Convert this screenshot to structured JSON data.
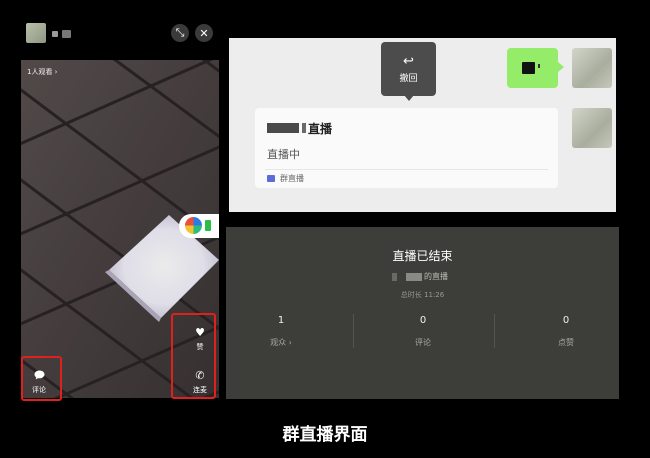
{
  "phone": {
    "viewer_count": "1人观看 ›",
    "like_label": "赞",
    "comment_label": "评论",
    "mic_label": "连麦",
    "close_glyph": "✕",
    "shrink_glyph": "⤡"
  },
  "chat": {
    "recall_icon": "↩",
    "recall_label": "撤回",
    "live_title": "直播",
    "live_status": "直播中",
    "group_live_label": "群直播",
    "group_live_icon": "live-icon"
  },
  "ended": {
    "title": "直播已结束",
    "host_suffix": "的直播",
    "duration": "总时长 11:26",
    "stats": [
      {
        "value": "1",
        "label": "观众 ›"
      },
      {
        "value": "0",
        "label": "评论"
      },
      {
        "value": "0",
        "label": "点赞"
      }
    ]
  },
  "caption": "群直播界面",
  "colors": {
    "highlight_red": "#e0201c",
    "bubble_green": "#95ec69",
    "ended_bg": "#3d3d3a",
    "chat_bg": "#ededed"
  }
}
